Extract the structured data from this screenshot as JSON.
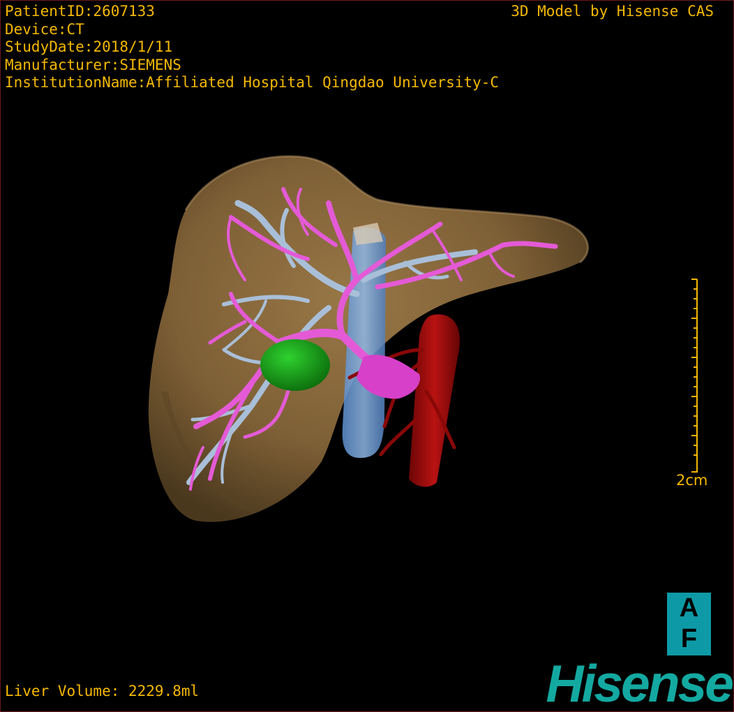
{
  "header": {
    "patient_id": "PatientID:2607133",
    "device": "Device:CT",
    "study_date": "StudyDate:2018/1/11",
    "manufacturer": "Manufacturer:SIEMENS",
    "institution": "InstitutionName:Affiliated Hospital Qingdao University-C",
    "credit": "3D Model by Hisense CAS"
  },
  "footer": {
    "liver_volume": "Liver Volume: 2229.8ml"
  },
  "scale": {
    "label": "2cm"
  },
  "orientation": {
    "top": "A",
    "bottom": "F"
  },
  "brand": "Hisense",
  "colors": {
    "overlay_text": "#f5b800",
    "liver": "#8a6a3c",
    "portal_vein": "#e45ad6",
    "hepatic_vein": "#a9bfd8",
    "vena_cava": "#6a9fd8",
    "aorta": "#a50b0b",
    "gallbladder": "#1aa31a",
    "brand": "#13a9a1",
    "orientation_box": "#0d9aa6"
  }
}
